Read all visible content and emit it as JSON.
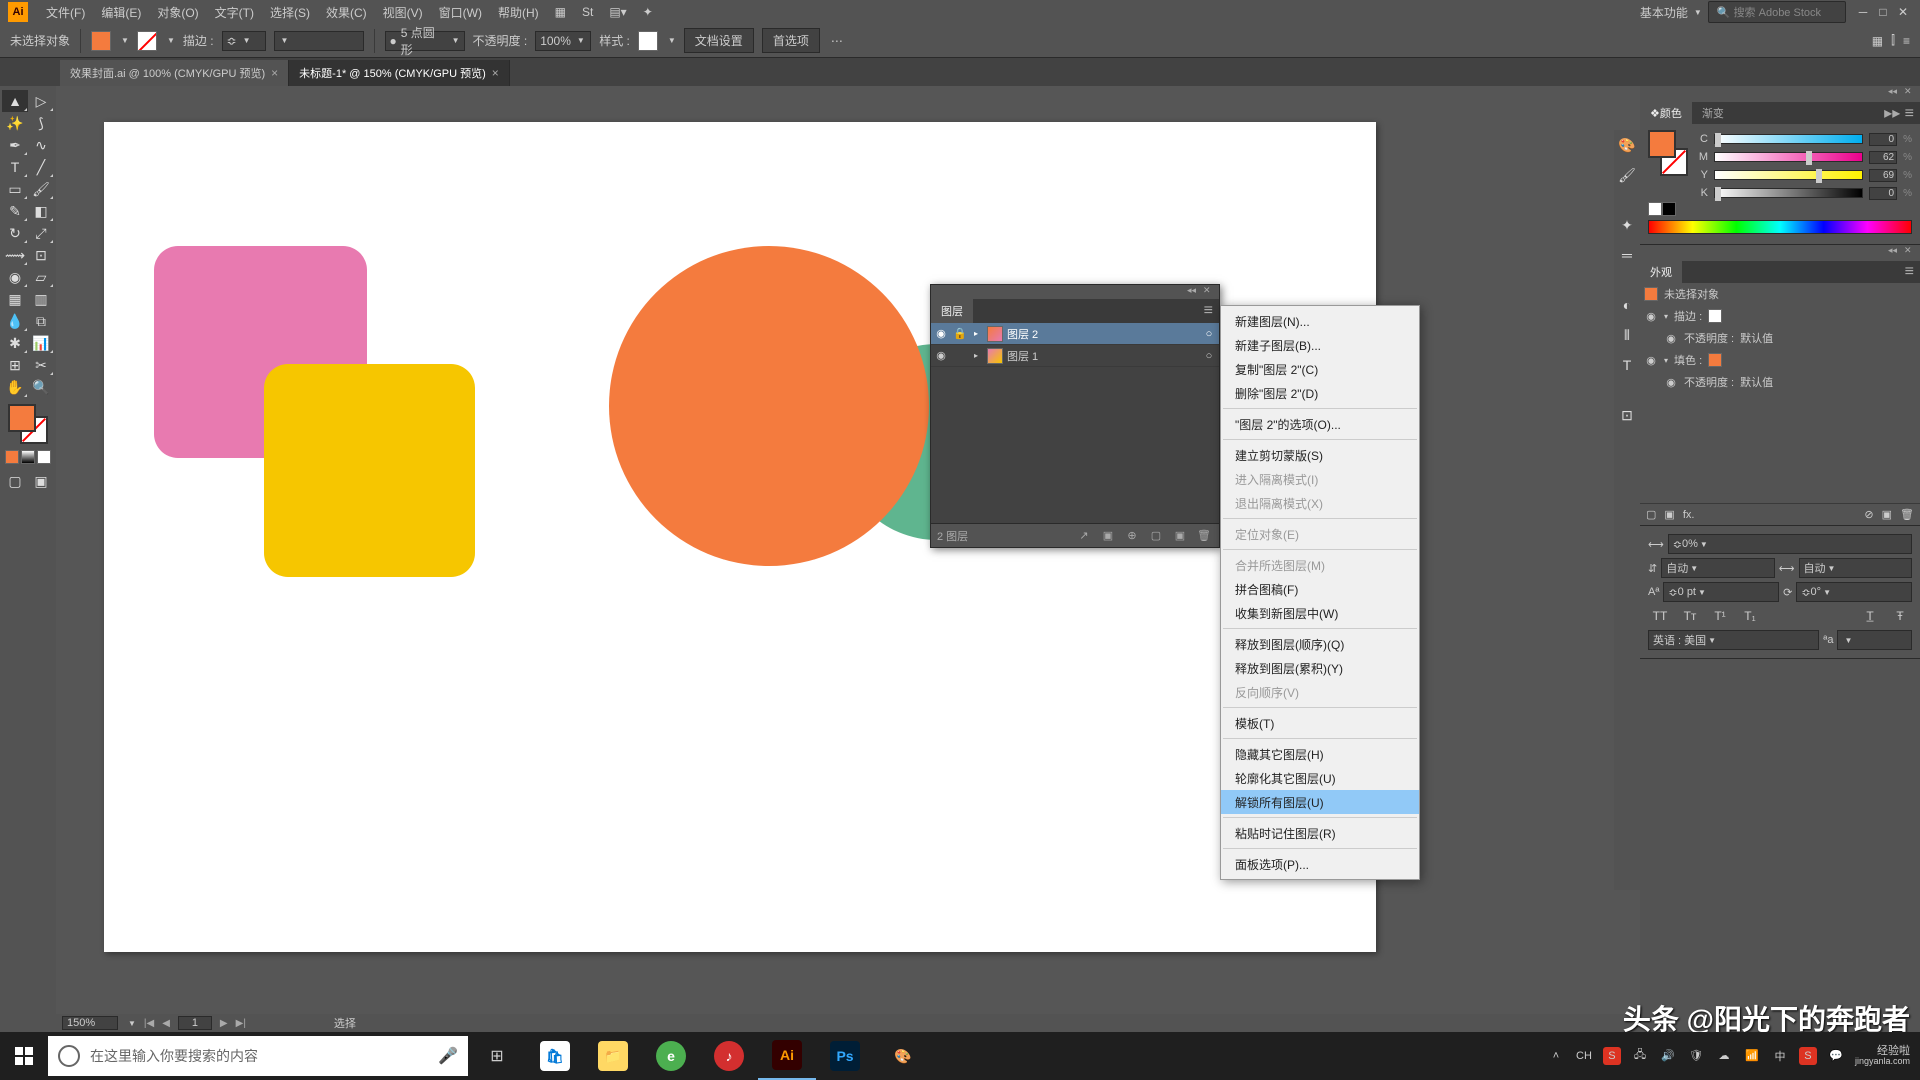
{
  "app": {
    "logo": "Ai"
  },
  "menu": {
    "file": "文件(F)",
    "edit": "编辑(E)",
    "object": "对象(O)",
    "type": "文字(T)",
    "select": "选择(S)",
    "effect": "效果(C)",
    "view": "视图(V)",
    "window": "窗口(W)",
    "help": "帮助(H)"
  },
  "workspace": {
    "label": "基本功能",
    "search_placeholder": "搜索 Adobe Stock"
  },
  "control": {
    "no_selection": "未选择对象",
    "stroke_label": "描边 :",
    "profile_label": "5 点圆形",
    "opacity_label": "不透明度 :",
    "opacity_value": "100%",
    "style_label": "样式 :",
    "doc_setup": "文档设置",
    "prefs": "首选项"
  },
  "tabs": [
    {
      "title": "效果封面.ai @ 100% (CMYK/GPU 预览)",
      "active": false
    },
    {
      "title": "未标题-1* @ 150% (CMYK/GPU 预览)",
      "active": true
    }
  ],
  "status": {
    "zoom": "150%",
    "page": "1",
    "info": "选择"
  },
  "color": {
    "tab1": "颜色",
    "tab2": "渐变",
    "labels": {
      "c": "C",
      "m": "M",
      "y": "Y",
      "k": "K"
    },
    "values": {
      "c": "0",
      "m": "62",
      "y": "69",
      "k": "0"
    }
  },
  "appearance": {
    "tab": "外观",
    "no_sel": "未选择对象",
    "stroke": "描边 :",
    "opacity": "不透明度 :",
    "default": "默认值",
    "fill": "填色 :"
  },
  "char": {
    "opacity_val": "0%",
    "auto": "自动",
    "zero_pt": "0 pt",
    "zero_deg": "0°",
    "lang_label": "英语 : 美国"
  },
  "layers": {
    "tab": "图层",
    "items": [
      {
        "name": "图层 2",
        "locked": true,
        "selected": true
      },
      {
        "name": "图层 1",
        "locked": false,
        "selected": false
      }
    ],
    "count": "2 图层"
  },
  "ctx": {
    "new_layer": "新建图层(N)...",
    "new_sublayer": "新建子图层(B)...",
    "copy_layer": "复制\"图层 2\"(C)",
    "delete_layer": "删除\"图层 2\"(D)",
    "layer_options": "\"图层 2\"的选项(O)...",
    "make_clip": "建立剪切蒙版(S)",
    "enter_iso": "进入隔离模式(I)",
    "exit_iso": "退出隔离模式(X)",
    "locate": "定位对象(E)",
    "merge_sel": "合并所选图层(M)",
    "flatten": "拼合图稿(F)",
    "collect": "收集到新图层中(W)",
    "release_seq": "释放到图层(顺序)(Q)",
    "release_build": "释放到图层(累积)(Y)",
    "reverse": "反向顺序(V)",
    "template": "模板(T)",
    "hide_others": "隐藏其它图层(H)",
    "outline_others": "轮廓化其它图层(U)",
    "unlock_all": "解锁所有图层(U)",
    "paste_remember": "粘贴时记住图层(R)",
    "panel_options": "面板选项(P)..."
  },
  "taskbar": {
    "search_placeholder": "在这里输入你要搜索的内容",
    "lang": "中",
    "tray_s": "S"
  },
  "watermark": {
    "main": "头条 @阳光下的奔跑者",
    "sub": "经验啦",
    "site": "jingyanla.com"
  }
}
